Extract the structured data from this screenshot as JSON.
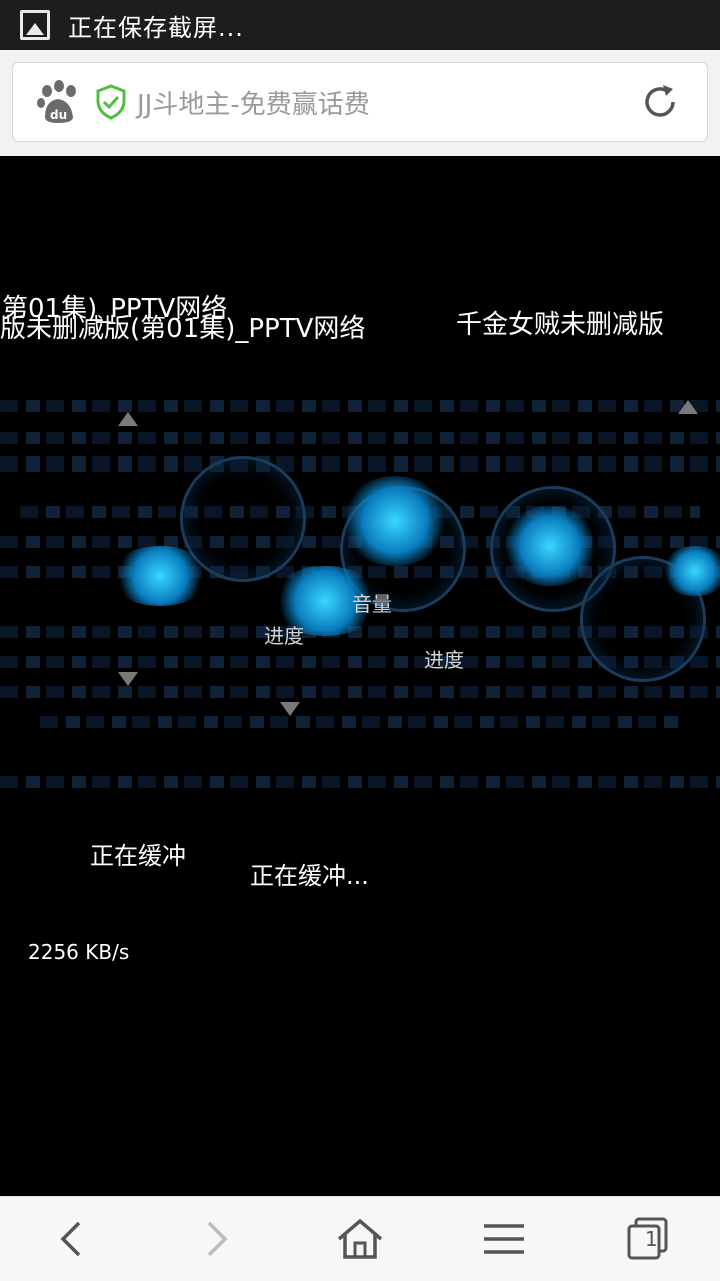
{
  "status_bar": {
    "notification_text": "正在保存截屏..."
  },
  "address_bar": {
    "page_title": "JJ斗地主-免费赢话费"
  },
  "video": {
    "title_line": "版未删减版(第01集)_PPTV网络",
    "title_fragment_right": "千金女贼未删减版",
    "title_fragment_left": "第01集)_PPTV网络",
    "volume_label": "音量",
    "progress_label": "进度",
    "progress_label_2": "进度",
    "buffering_text": "正在缓冲...",
    "buffering_fragment": "正在缓冲",
    "speed_text": "2256 KB/s"
  },
  "bottom_bar": {
    "tab_count": "1"
  }
}
